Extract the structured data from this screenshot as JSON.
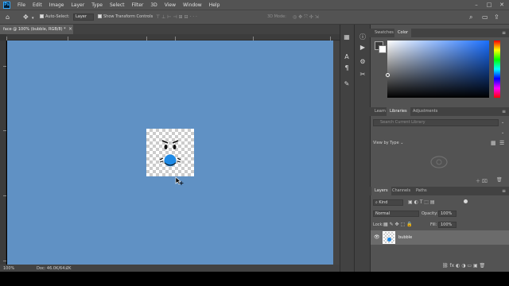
{
  "app": {
    "logo": "Ps",
    "menu": [
      "File",
      "Edit",
      "Image",
      "Layer",
      "Type",
      "Select",
      "Filter",
      "3D",
      "View",
      "Window",
      "Help"
    ],
    "window_controls": [
      "–",
      "□",
      "✕"
    ]
  },
  "options_bar": {
    "auto_select_label": "Auto-Select:",
    "auto_select_target": "Layer",
    "show_transform_label": "Show Transform Controls",
    "mode_3d_label": "3D Mode:"
  },
  "document": {
    "tab_title": "face @ 100% (bubble, RGB/8) *",
    "tab_close": "×",
    "zoom": "100%",
    "doc_info": "Doc: 46.0K/64.2K"
  },
  "swatches_panel": {
    "tabs": [
      "Swatches",
      "Color"
    ],
    "active_tab": "Color"
  },
  "libraries_panel": {
    "tabs": [
      "Learn",
      "Libraries",
      "Adjustments"
    ],
    "active_tab": "Libraries",
    "search_placeholder": "Search Current Library",
    "view_by": "View by Type"
  },
  "layers_panel": {
    "tabs": [
      "Layers",
      "Channels",
      "Paths"
    ],
    "active_tab": "Layers",
    "filter_kind": "Kind",
    "blend_mode": "Normal",
    "opacity_label": "Opacity:",
    "opacity_value": "100%",
    "lock_label": "Lock:",
    "fill_label": "Fill:",
    "fill_value": "100%",
    "layers": [
      {
        "name": "bubble",
        "visible": true
      }
    ]
  },
  "colors": {
    "canvas_bg": "#6091c4",
    "bubble_blue": "#1e8ae6",
    "ui_dark": "#424242",
    "ui_mid": "#535353"
  }
}
